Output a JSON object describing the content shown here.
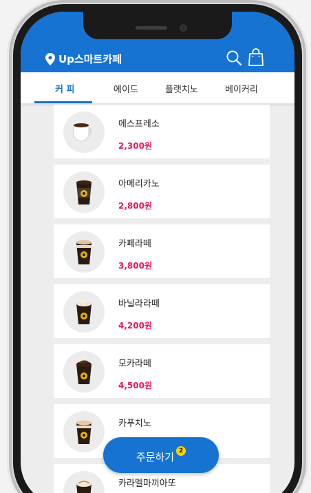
{
  "header": {
    "store_name": "Up스마트카페",
    "icons": [
      "location-pin-icon",
      "search-icon",
      "shopping-bag-icon"
    ],
    "bg_color": "#1773d2"
  },
  "tabs": [
    {
      "label": "커 피",
      "active": true
    },
    {
      "label": "에이드",
      "active": false
    },
    {
      "label": "플랫치노",
      "active": false
    },
    {
      "label": "베이커리",
      "active": false
    }
  ],
  "menu": [
    {
      "name": "에스프레소",
      "price": "2,300원",
      "icon": "espresso-cup-icon"
    },
    {
      "name": "아메리카노",
      "price": "2,800원",
      "icon": "americano-cup-icon"
    },
    {
      "name": "카페라떼",
      "price": "3,800원",
      "icon": "latte-cup-icon"
    },
    {
      "name": "바닐라라떼",
      "price": "4,200원",
      "icon": "vanilla-latte-cup-icon"
    },
    {
      "name": "모카라떼",
      "price": "4,500원",
      "icon": "mocha-latte-cup-icon"
    },
    {
      "name": "카푸치노",
      "price": "",
      "icon": "cappuccino-cup-icon"
    },
    {
      "name": "카라멜마끼아또",
      "price": "",
      "icon": "caramel-macchiato-cup-icon"
    }
  ],
  "order_button": {
    "label": "주문하기",
    "badge_count": "2"
  },
  "colors": {
    "price": "#e8175d",
    "badge": "#ffd200",
    "accent": "#1773d2"
  }
}
